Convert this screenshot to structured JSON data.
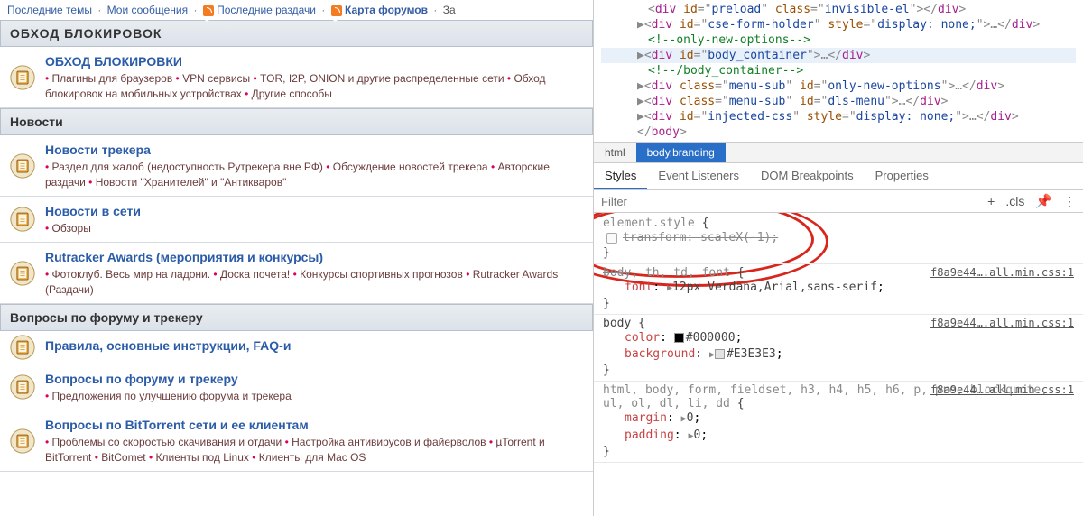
{
  "topnav": {
    "recent_topics": "Последние темы",
    "my_messages": "Мои сообщения",
    "recent_uploads": "Последние раздачи",
    "forum_map": "Карта форумов",
    "cut": "За"
  },
  "cats": [
    {
      "head": "ОБХОД БЛОКИРОВОК",
      "upper": true,
      "forums": [
        {
          "title": "ОБХОД БЛОКИРОВКИ",
          "desc_parts": [
            "Плагины для браузеров",
            "VPN сервисы",
            "TOR, I2P, ONION и другие распределенные сети",
            "Обход блокировок на мобильных устройствах",
            "Другие способы"
          ]
        }
      ]
    },
    {
      "head": "Новости",
      "upper": false,
      "forums": [
        {
          "title": "Новости трекера",
          "desc_parts": [
            "Раздел для жалоб (недоступность Рутрекера вне РФ)",
            "Обсуждение новостей трекера",
            "Авторские раздачи",
            "Новости \"Хранителей\" и \"Антикваров\""
          ]
        },
        {
          "title": "Новости в сети",
          "desc_parts": [
            "Обзоры"
          ]
        },
        {
          "title": "Rutracker Awards (мероприятия и конкурсы)",
          "desc_parts": [
            "Фотоклуб. Весь мир на ладони.",
            "Доска почета!",
            "Конкурсы спортивных прогнозов",
            "Rutracker Awards (Раздачи)"
          ]
        }
      ]
    },
    {
      "head": "Вопросы по форуму и трекеру",
      "upper": false,
      "forums": [
        {
          "title": "Правила, основные инструкции, FAQ-и",
          "desc_parts": []
        },
        {
          "title": "Вопросы по форуму и трекеру",
          "desc_parts": [
            "Предложения по улучшению форума и трекера"
          ]
        },
        {
          "title": "Вопросы по BitTorrent сети и ее клиентам",
          "desc_parts": [
            "Проблемы со скоростью скачивания и отдачи",
            "Настройка антивирусов и файерволов",
            "µTorrent и BitTorrent",
            "BitComet",
            "Клиенты под Linux",
            "Клиенты для Mac OS"
          ]
        }
      ]
    }
  ],
  "dom": {
    "l1": {
      "id": "preload",
      "cls": "invisible-el"
    },
    "l2": {
      "id": "cse-form-holder",
      "sty": "display: none;"
    },
    "c1": "only-new-options",
    "l3": {
      "id": "body_container"
    },
    "c2": "/body_container",
    "l4": {
      "cls": "menu-sub",
      "id": "only-new-options"
    },
    "l5": {
      "cls": "menu-sub",
      "id": "dls-menu"
    },
    "l6": {
      "id": "injected-css",
      "sty": "display: none;"
    },
    "close": "body"
  },
  "crumbs": {
    "html": "html",
    "body": "body.branding"
  },
  "tabs": {
    "styles": "Styles",
    "ev": "Event Listeners",
    "dom": "DOM Breakpoints",
    "prop": "Properties"
  },
  "filter": {
    "ph": "Filter",
    "cls": ".cls"
  },
  "styles": {
    "b1": {
      "sel": "element.style",
      "prop": "transform",
      "val": "scaleX(-1)"
    },
    "b2": {
      "sel": "body, th, td, font",
      "src": "f8a9e44….all.min.css:1",
      "prop": "font",
      "val": "12px Verdana,Arial,sans-serif"
    },
    "b3": {
      "sel": "body",
      "src": "f8a9e44….all.min.css:1",
      "p1n": "color",
      "p1v": "#000000",
      "p2n": "background",
      "p2v": "#E3E3E3"
    },
    "b4": {
      "sel": "html, body, form, fieldset, h3, h4, h5, h6, p, pre, blockquote, ul, ol, dl, li, dd",
      "src": "f8a9e44….all.min.css:1",
      "p1n": "margin",
      "p1v": "0",
      "p2n": "padding",
      "p2v": "0"
    }
  }
}
